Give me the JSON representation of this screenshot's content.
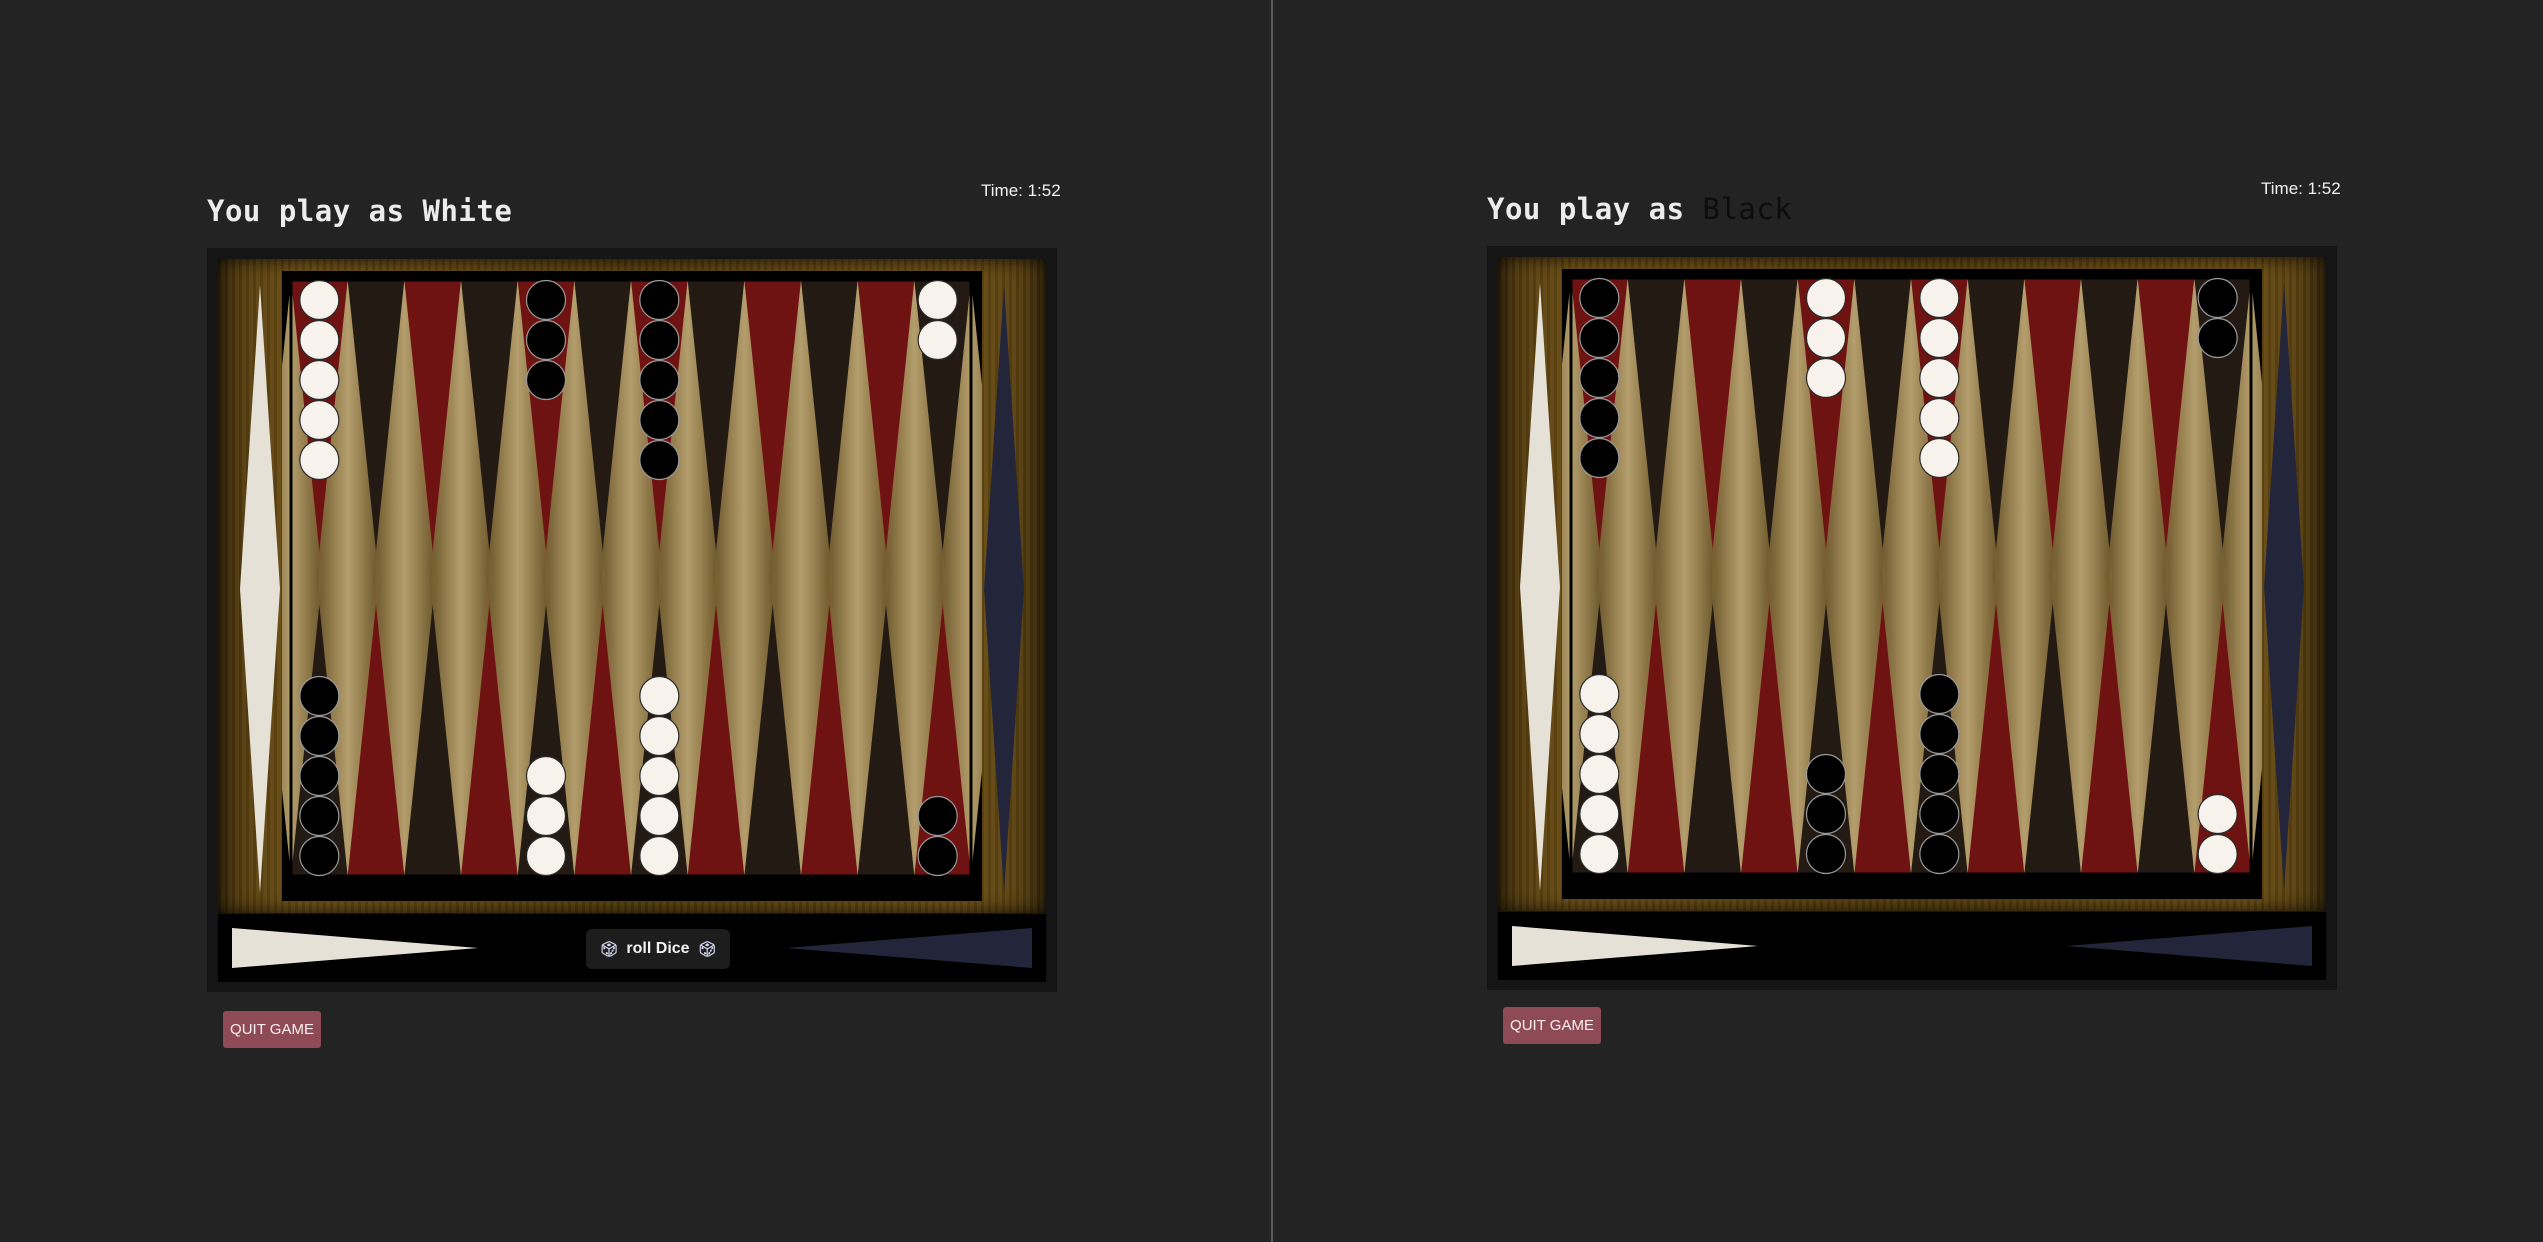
{
  "colors": {
    "background": "#232323",
    "point_red": "#6e1212",
    "point_dark": "#241a14",
    "point_wood": "#9b8350",
    "white_checker": "#f7f3ec",
    "black_checker": "#000000",
    "white_home": "#e6e1d7",
    "black_home": "#23263a",
    "quit_button": "#8e4b55"
  },
  "panels": [
    {
      "title_prefix": "You play as ",
      "player_color": "White",
      "timer": "Time: 1:52",
      "roll_button": {
        "label": "roll Dice",
        "icon": "dice-icon"
      },
      "quit_label": "QUIT GAME",
      "checkers": {
        "top": [
          {
            "col": 0,
            "color": "white",
            "count": 5
          },
          {
            "col": 4,
            "color": "black",
            "count": 3
          },
          {
            "col": 6,
            "color": "black",
            "count": 5
          },
          {
            "col": 11,
            "color": "white",
            "count": 2
          }
        ],
        "bottom": [
          {
            "col": 0,
            "color": "black",
            "count": 5
          },
          {
            "col": 4,
            "color": "white",
            "count": 3
          },
          {
            "col": 6,
            "color": "white",
            "count": 5
          },
          {
            "col": 11,
            "color": "black",
            "count": 2
          }
        ]
      }
    },
    {
      "title_prefix": "You play as ",
      "player_color": "Black",
      "timer": "Time: 1:52",
      "roll_button": null,
      "quit_label": "QUIT GAME",
      "checkers": {
        "top": [
          {
            "col": 0,
            "color": "black",
            "count": 5
          },
          {
            "col": 4,
            "color": "white",
            "count": 3
          },
          {
            "col": 6,
            "color": "white",
            "count": 5
          },
          {
            "col": 11,
            "color": "black",
            "count": 2
          }
        ],
        "bottom": [
          {
            "col": 0,
            "color": "white",
            "count": 5
          },
          {
            "col": 4,
            "color": "black",
            "count": 3
          },
          {
            "col": 6,
            "color": "black",
            "count": 5
          },
          {
            "col": 11,
            "color": "white",
            "count": 2
          }
        ]
      }
    }
  ]
}
